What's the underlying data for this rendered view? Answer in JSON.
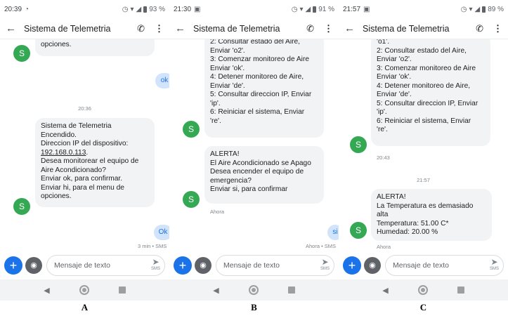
{
  "app_title": "Sistema de Telemetria",
  "compose_placeholder": "Mensaje de texto",
  "send_label": "SMS",
  "panels": [
    {
      "label": "A",
      "status": {
        "time": "20:39",
        "battery": "93 %"
      },
      "messages": {
        "in1": "opciones.",
        "out1": "ok",
        "sep1": "20:36",
        "in2_pre": "Sistema de Telemetria\nEncendido.\nDireccion IP del dispositivo:",
        "in2_ip": "192.168.0.113",
        "in2_ip_tail": ".",
        "in2_post": "Desea monitorear el equipo de\nAire Acondicionado?\nEnviar ok, para confirmar.\nEnviar hi, para el menu de\nopciones.",
        "out2": "Ok",
        "out2_meta": "3 min • SMS"
      },
      "avatar_letter": "S"
    },
    {
      "label": "B",
      "status": {
        "time": "21:30",
        "battery": "91 %"
      },
      "messages": {
        "in1": "2: Consultar estado del Aire,\nEnviar 'o2'.\n3: Comenzar monitoreo de Aire\nEnviar 'ok'.\n4: Detener monitoreo de Aire,\nEnviar 'de'.\n5: Consultar direccion IP, Enviar\n'ip'.\n6: Reiniciar el sistema, Enviar\n're'.",
        "in2": "ALERTA!\nEl Aire Acondicionado se Apago\nDesea encender el equipo de\nemergencia?\nEnviar si, para confirmar",
        "in2_meta": "Ahora",
        "out1": "si",
        "out1_meta": "Ahora • SMS"
      },
      "avatar_letter": "S"
    },
    {
      "label": "C",
      "status": {
        "time": "21:57",
        "battery": "89 %"
      },
      "messages": {
        "in1": "'o1'.\n2: Consultar estado del Aire,\nEnviar 'o2'.\n3: Comenzar monitoreo de Aire\nEnviar 'ok'.\n4: Detener monitoreo de Aire,\nEnviar 'de'.\n5: Consultar direccion IP, Enviar\n'ip'.\n6: Reiniciar el sistema, Enviar\n're'.",
        "in1_meta": "20:43",
        "sep1": "21:57",
        "in2": "ALERTA!\nLa Temperatura es demasiado\nalta\nTemperatura: 51.00 C*\nHumedad: 20.00 %",
        "in2_meta": "Ahora"
      },
      "avatar_letter": "S"
    }
  ],
  "icons": {
    "back": "arrow-left-icon",
    "call": "phone-icon",
    "more": "more-vert-icon",
    "plus": "plus-icon",
    "camera": "camera-icon",
    "send": "send-icon",
    "avatar_color": "#34a853",
    "accent": "#1a73e8"
  }
}
